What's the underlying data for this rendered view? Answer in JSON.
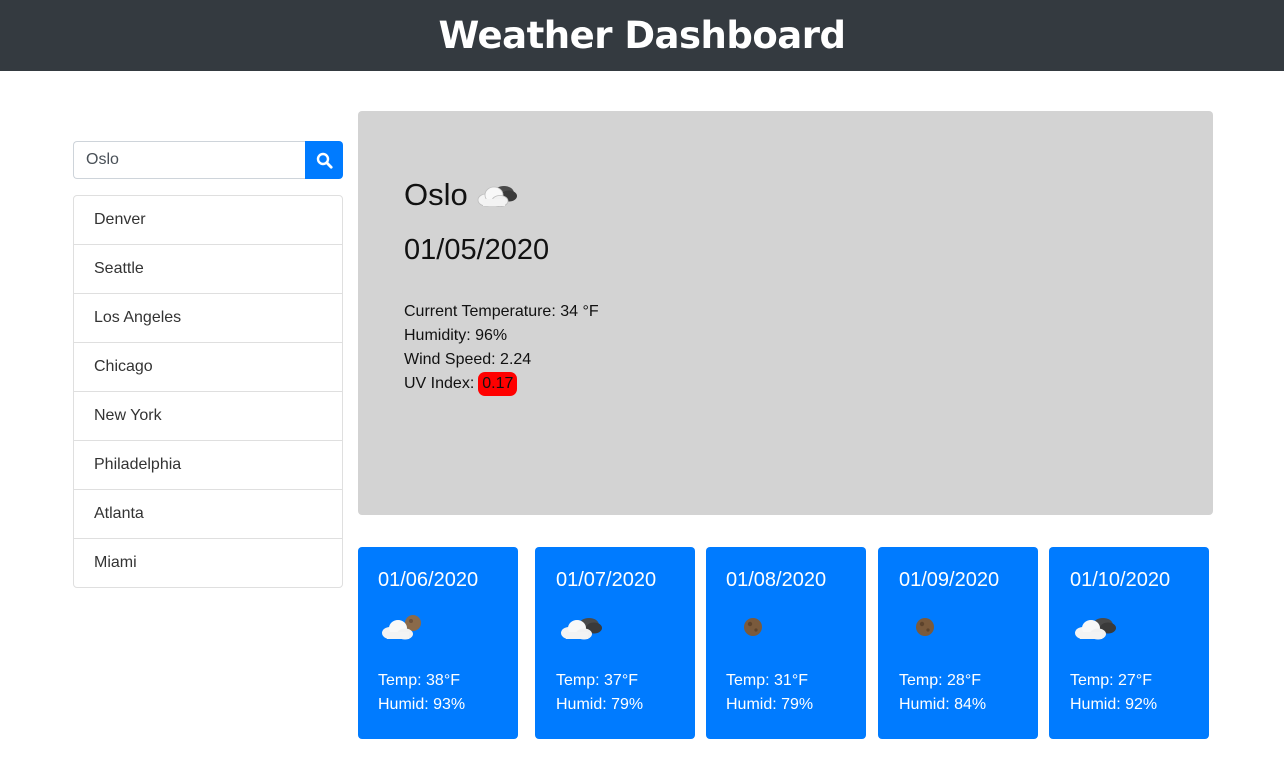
{
  "header": {
    "title": "Weather Dashboard"
  },
  "search": {
    "value": "Oslo",
    "button_icon": "search-icon"
  },
  "history": [
    "Denver",
    "Seattle",
    "Los Angeles",
    "Chicago",
    "New York",
    "Philadelphia",
    "Atlanta",
    "Miami"
  ],
  "current": {
    "city": "Oslo",
    "icon": "cloud-night-icon",
    "date": "01/05/2020",
    "temperature": "Current Temperature: 34 °F",
    "humidity": "Humidity: 96%",
    "wind": "Wind Speed: 2.24",
    "uv_label": "UV Index:",
    "uv_value": "0.17",
    "uv_color": "#ff0000",
    "panel_color": "#d3d3d3"
  },
  "forecast": [
    {
      "date": "01/06/2020",
      "icon": "cloud-moon-icon",
      "temp": "Temp: 38°F",
      "humid": "Humid: 93%"
    },
    {
      "date": "01/07/2020",
      "icon": "cloud-night-icon",
      "temp": "Temp: 37°F",
      "humid": "Humid: 79%"
    },
    {
      "date": "01/08/2020",
      "icon": "moon-icon",
      "temp": "Temp: 31°F",
      "humid": "Humid: 79%"
    },
    {
      "date": "01/09/2020",
      "icon": "moon-icon",
      "temp": "Temp: 28°F",
      "humid": "Humid: 84%"
    },
    {
      "date": "01/10/2020",
      "icon": "cloud-night-icon",
      "temp": "Temp: 27°F",
      "humid": "Humid: 92%"
    }
  ],
  "colors": {
    "header": "#343a40",
    "accent": "#007bff"
  }
}
